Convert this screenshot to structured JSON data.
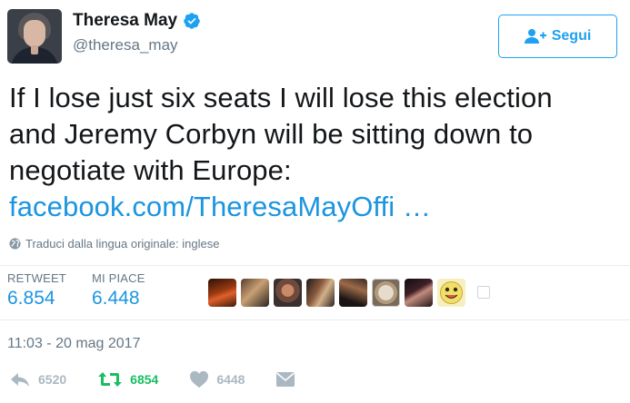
{
  "user": {
    "display_name": "Theresa May",
    "handle": "@theresa_may",
    "verified": true
  },
  "follow_button": {
    "label": "Segui"
  },
  "tweet": {
    "lines": [
      "If I lose just six seats I will lose this election",
      "and Jeremy Corbyn will be sitting down to",
      "negotiate with Europe:"
    ],
    "link_text": "facebook.com/TheresaMayOffi …"
  },
  "translate": {
    "text": "Traduci dalla lingua originale: inglese"
  },
  "stats": {
    "retweet_label": "RETWEET",
    "retweet_value": "6.854",
    "likes_label": "MI PIACE",
    "likes_value": "6.448"
  },
  "timestamp": "11:03 - 20 mag 2017",
  "actions": {
    "reply_count": "6520",
    "retweet_count": "6854",
    "like_count": "6448"
  },
  "colors": {
    "link": "#1b95e0",
    "retweet_active": "#17bf63",
    "muted": "#657786",
    "icon_muted": "#aab8c2"
  }
}
